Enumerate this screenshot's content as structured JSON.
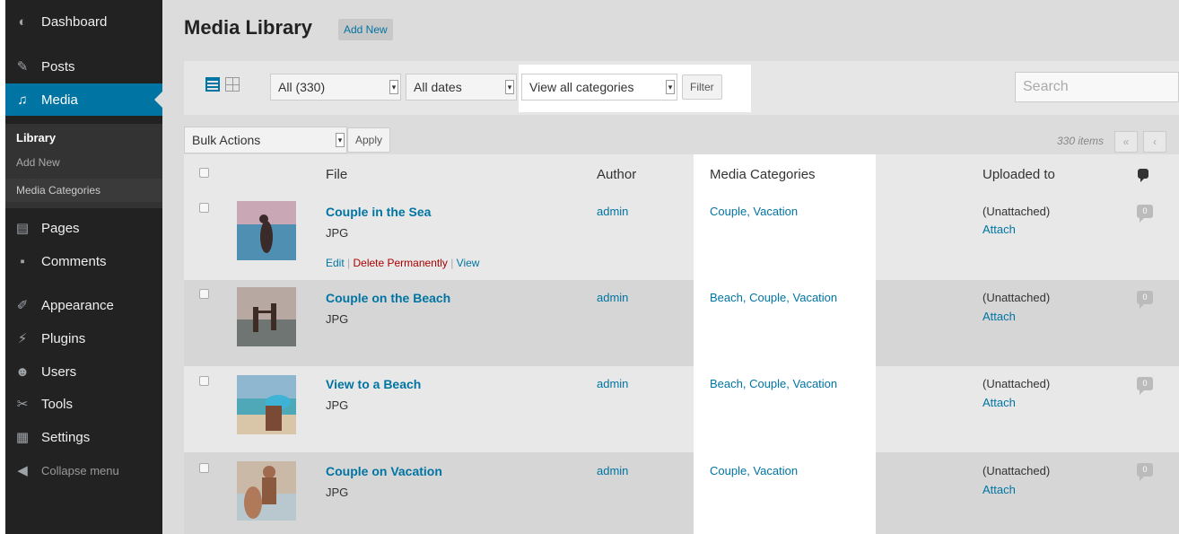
{
  "sidebar": {
    "items": [
      {
        "label": "Dashboard",
        "icon": "dashboard-icon"
      },
      {
        "label": "Posts",
        "icon": "pin-icon"
      },
      {
        "label": "Media",
        "icon": "media-icon"
      },
      {
        "label": "Pages",
        "icon": "page-icon"
      },
      {
        "label": "Comments",
        "icon": "comment-icon"
      },
      {
        "label": "Appearance",
        "icon": "brush-icon"
      },
      {
        "label": "Plugins",
        "icon": "plugin-icon"
      },
      {
        "label": "Users",
        "icon": "users-icon"
      },
      {
        "label": "Tools",
        "icon": "wrench-icon"
      },
      {
        "label": "Settings",
        "icon": "settings-icon"
      },
      {
        "label": "Collapse menu",
        "icon": "collapse-icon"
      }
    ],
    "submenu": [
      "Library",
      "Add New",
      "Media Categories"
    ]
  },
  "header": {
    "title": "Media Library",
    "add_new": "Add New"
  },
  "toolbar": {
    "filter_type": "All (330)",
    "filter_date": "All dates",
    "filter_category": "View all categories",
    "filter_button": "Filter",
    "search_placeholder": "Search"
  },
  "bulk": {
    "label": "Bulk Actions",
    "apply": "Apply",
    "count": "330 items",
    "first": "«",
    "prev": "‹"
  },
  "table": {
    "headers": {
      "file": "File",
      "author": "Author",
      "categories": "Media Categories",
      "uploaded": "Uploaded to"
    },
    "rows": [
      {
        "title": "Couple in the Sea",
        "type": "JPG",
        "author": "admin",
        "categories": "Couple, Vacation",
        "uploaded": "(Unattached)",
        "attach": "Attach",
        "comments": "0",
        "actions": {
          "edit": "Edit",
          "delete": "Delete Permanently",
          "view": "View"
        }
      },
      {
        "title": "Couple on the Beach",
        "type": "JPG",
        "author": "admin",
        "categories": "Beach, Couple, Vacation",
        "uploaded": "(Unattached)",
        "attach": "Attach",
        "comments": "0"
      },
      {
        "title": "View to a Beach",
        "type": "JPG",
        "author": "admin",
        "categories": "Beach, Couple, Vacation",
        "uploaded": "(Unattached)",
        "attach": "Attach",
        "comments": "0"
      },
      {
        "title": "Couple on Vacation",
        "type": "JPG",
        "author": "admin",
        "categories": "Couple, Vacation",
        "uploaded": "(Unattached)",
        "attach": "Attach",
        "comments": "0"
      }
    ]
  },
  "colors": {
    "accent": "#0074a2",
    "sidebar_bg": "#222222",
    "delete": "#aa0000"
  }
}
